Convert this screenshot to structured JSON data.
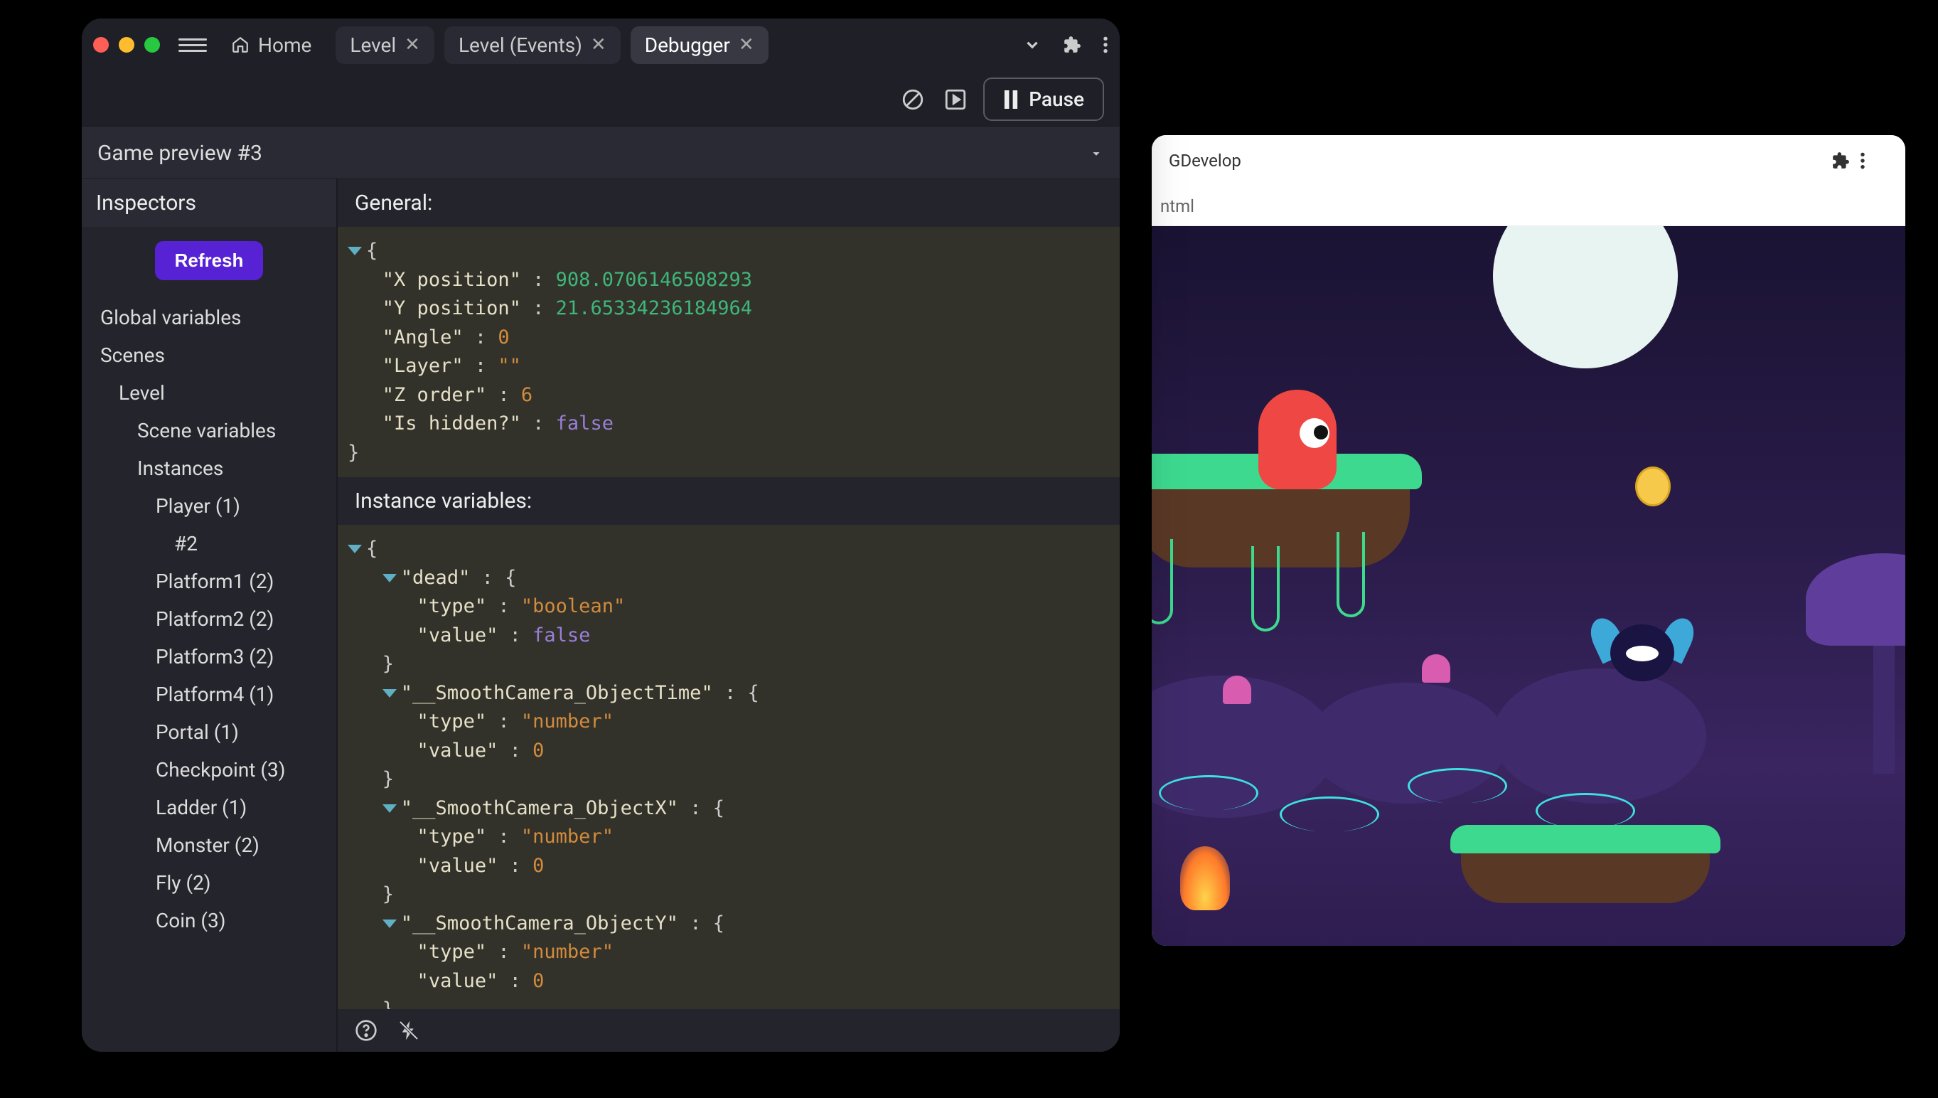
{
  "editor": {
    "tabs": {
      "home": "Home",
      "level": "Level",
      "events": "Level (Events)",
      "debugger": "Debugger"
    },
    "pause_label": "Pause",
    "preview_label": "Game preview #3",
    "inspectors_header": "Inspectors",
    "refresh_label": "Refresh",
    "tree": {
      "global_variables": "Global variables",
      "scenes": "Scenes",
      "level": "Level",
      "scene_variables": "Scene variables",
      "instances": "Instances",
      "player": "Player (1)",
      "instance_num": "#2",
      "platform1": "Platform1 (2)",
      "platform2": "Platform2 (2)",
      "platform3": "Platform3 (2)",
      "platform4": "Platform4 (1)",
      "portal": "Portal (1)",
      "checkpoint": "Checkpoint (3)",
      "ladder": "Ladder (1)",
      "monster": "Monster (2)",
      "fly": "Fly (2)",
      "coin": "Coin (3)"
    },
    "detail": {
      "general_header": "General:",
      "instance_vars_header": "Instance variables:",
      "general": {
        "x_pos_key": "X position",
        "x_pos_val": "908.0706146508293",
        "y_pos_key": "Y position",
        "y_pos_val": "21.65334236184964",
        "angle_key": "Angle",
        "angle_val": "0",
        "layer_key": "Layer",
        "layer_val": "\"\"",
        "zorder_key": "Z order",
        "zorder_val": "6",
        "hidden_key": "Is hidden?",
        "hidden_val": "false"
      },
      "vars": {
        "dead_key": "dead",
        "type_key": "type",
        "value_key": "value",
        "bool_type": "\"boolean\"",
        "num_type": "\"number\"",
        "false_val": "false",
        "zero_val": "0",
        "sc_time_key": "__SmoothCamera_ObjectTime",
        "sc_x_key": "__SmoothCamera_ObjectX",
        "sc_y_key": "__SmoothCamera_ObjectY"
      }
    }
  },
  "game": {
    "title": "GDevelop",
    "url_fragment": "ntml"
  }
}
